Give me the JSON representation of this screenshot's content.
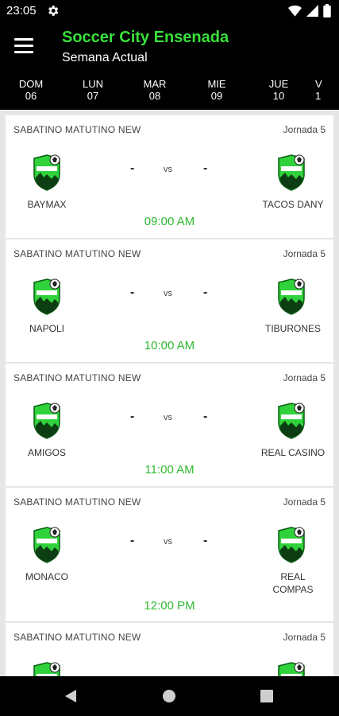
{
  "status": {
    "time": "23:05"
  },
  "header": {
    "title": "Soccer City Ensenada",
    "subtitle": "Semana Actual"
  },
  "days": [
    {
      "day": "DOM",
      "date": "06"
    },
    {
      "day": "LUN",
      "date": "07"
    },
    {
      "day": "MAR",
      "date": "08"
    },
    {
      "day": "MIE",
      "date": "09"
    },
    {
      "day": "JUE",
      "date": "10"
    },
    {
      "day": "V",
      "date": "1"
    }
  ],
  "matches": [
    {
      "league": "SABATINO MATUTINO NEW",
      "round": "Jornada 5",
      "home": "BAYMAX",
      "away": "TACOS DANY",
      "home_score": "-",
      "vs": "vs",
      "away_score": "-",
      "time": "09:00 AM"
    },
    {
      "league": "SABATINO MATUTINO NEW",
      "round": "Jornada 5",
      "home": "NAPOLI",
      "away": "TIBURONES",
      "home_score": "-",
      "vs": "vs",
      "away_score": "-",
      "time": "10:00 AM"
    },
    {
      "league": "SABATINO MATUTINO NEW",
      "round": "Jornada 5",
      "home": "AMIGOS",
      "away": "REAL CASINO",
      "home_score": "-",
      "vs": "vs",
      "away_score": "-",
      "time": "11:00 AM"
    },
    {
      "league": "SABATINO MATUTINO NEW",
      "round": "Jornada 5",
      "home": "MONACO",
      "away": "REAL\nCOMPAS",
      "home_score": "-",
      "vs": "vs",
      "away_score": "-",
      "time": "12:00 PM"
    },
    {
      "league": "SABATINO MATUTINO NEW",
      "round": "Jornada 5",
      "home": "",
      "away": "",
      "home_score": "",
      "vs": "",
      "away_score": "",
      "time": ""
    }
  ],
  "colors": {
    "accent": "#38e03a",
    "time_green": "#2fba2f",
    "background": "#000000",
    "list_bg": "#e6e6e6"
  },
  "icons": {
    "menu": "menu-icon",
    "settings": "gear-icon",
    "team_logo": "soccer-shield-icon",
    "back": "back-icon",
    "home": "home-icon",
    "recents": "recents-icon"
  }
}
